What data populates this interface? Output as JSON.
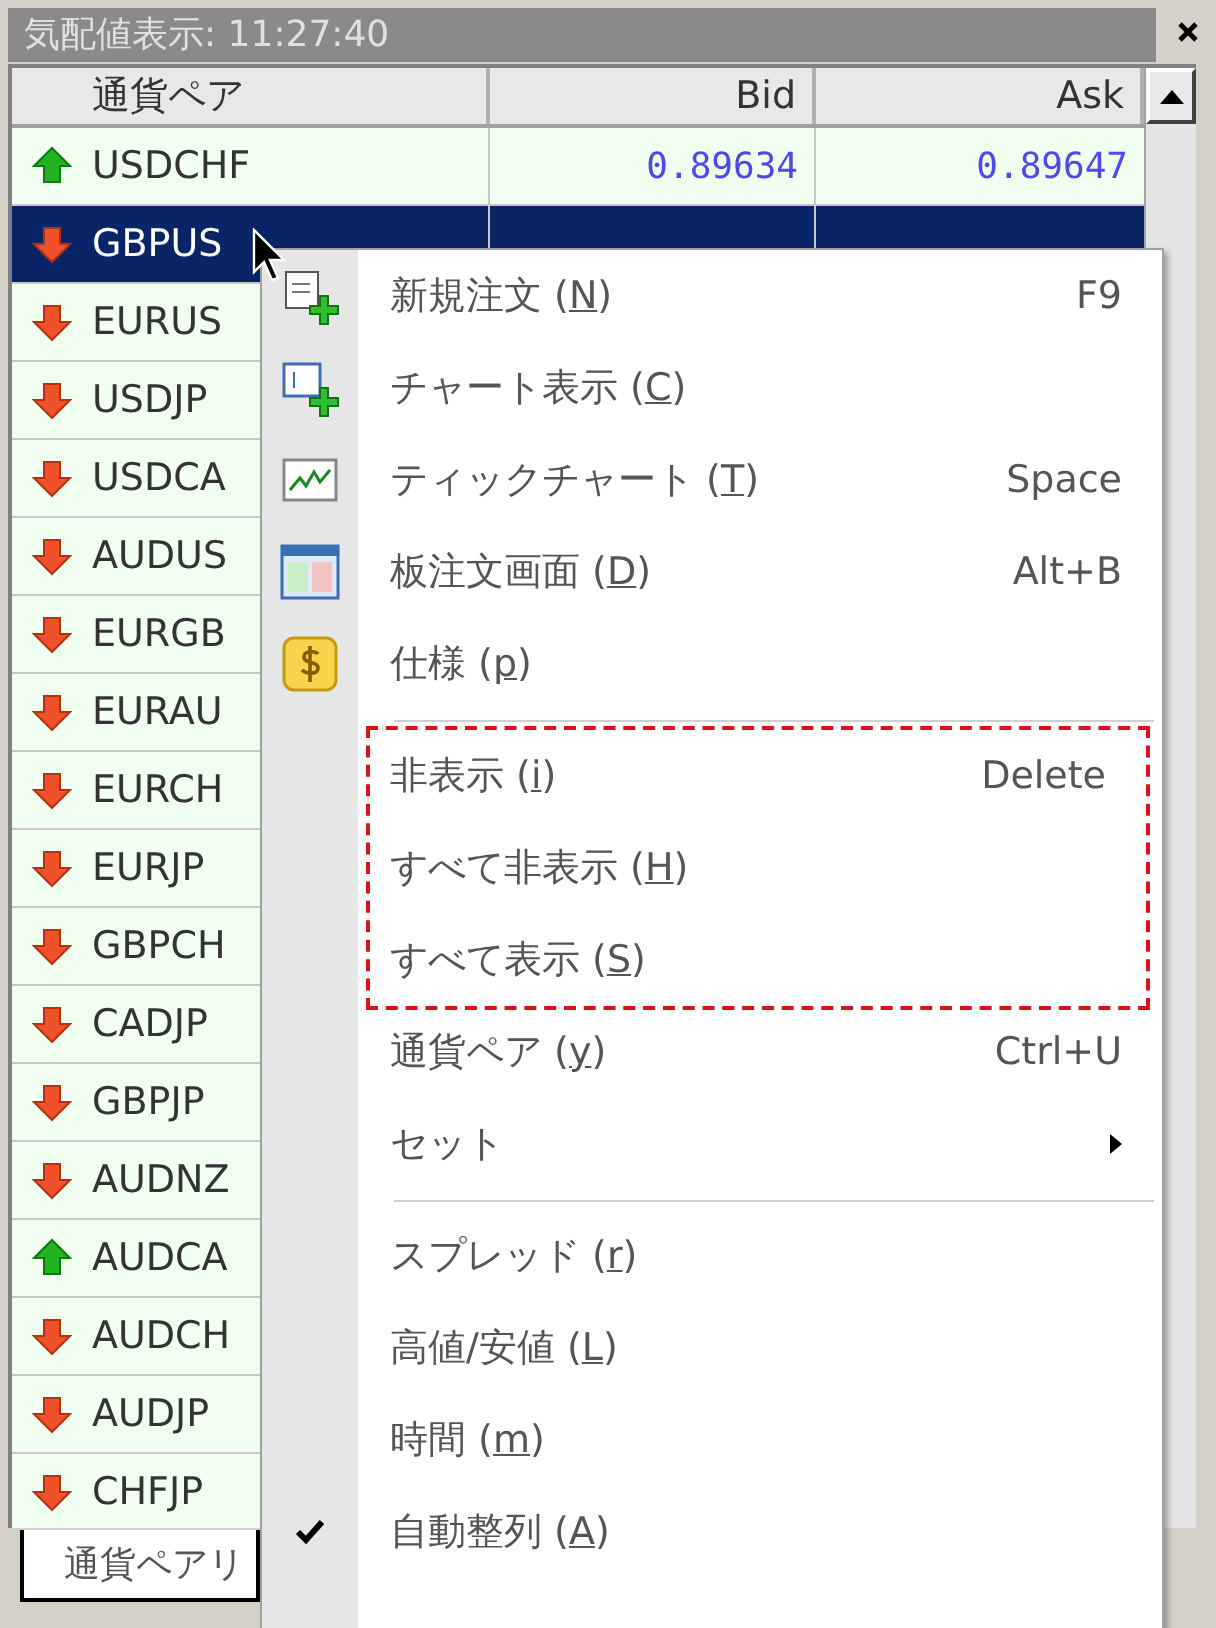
{
  "window": {
    "title": "気配値表示: 11:27:40"
  },
  "table": {
    "columns": [
      "通貨ペア",
      "Bid",
      "Ask"
    ],
    "rows": [
      {
        "symbol": "USDCHF",
        "rising": true,
        "bid": "0.89634",
        "ask": "0.89647",
        "selected": false
      },
      {
        "symbol": "GBPUS",
        "rising": false,
        "selected": true
      },
      {
        "symbol": "EURUS",
        "rising": false,
        "selected": false
      },
      {
        "symbol": "USDJP",
        "rising": false,
        "selected": false
      },
      {
        "symbol": "USDCA",
        "rising": false,
        "selected": false
      },
      {
        "symbol": "AUDUS",
        "rising": false,
        "selected": false
      },
      {
        "symbol": "EURGB",
        "rising": false,
        "selected": false
      },
      {
        "symbol": "EURAU",
        "rising": false,
        "selected": false
      },
      {
        "symbol": "EURCH",
        "rising": false,
        "selected": false
      },
      {
        "symbol": "EURJP",
        "rising": false,
        "selected": false
      },
      {
        "symbol": "GBPCH",
        "rising": false,
        "selected": false
      },
      {
        "symbol": "CADJP",
        "rising": false,
        "selected": false
      },
      {
        "symbol": "GBPJP",
        "rising": false,
        "selected": false
      },
      {
        "symbol": "AUDNZ",
        "rising": false,
        "selected": false
      },
      {
        "symbol": "AUDCA",
        "rising": true,
        "selected": false
      },
      {
        "symbol": "AUDCH",
        "rising": false,
        "selected": false
      },
      {
        "symbol": "AUDJP",
        "rising": false,
        "selected": false
      },
      {
        "symbol": "CHFJP",
        "rising": false,
        "selected": false
      }
    ]
  },
  "bottom_tab": {
    "label": "通貨ペアリ"
  },
  "context_menu": {
    "sections": [
      {
        "divider": false,
        "outlined": false,
        "items": [
          {
            "before": "新規注文 (",
            "mnemonic": "N",
            "after": ")",
            "shortcut": "F9",
            "checked": false
          },
          {
            "before": "チャート表示 (",
            "mnemonic": "C",
            "after": ")",
            "checked": false
          },
          {
            "before": "ティックチャート (",
            "mnemonic": "T",
            "after": ")",
            "shortcut": "Space",
            "checked": false
          },
          {
            "before": "板注文画面 (",
            "mnemonic": "D",
            "after": ")",
            "shortcut": "Alt+B",
            "checked": false
          },
          {
            "before": "仕様 (",
            "mnemonic": "p",
            "after": ")",
            "checked": false
          }
        ]
      },
      {
        "divider": true,
        "outlined": true,
        "items": [
          {
            "before": "非表示 (",
            "mnemonic": "i",
            "after": ")",
            "shortcut": "Delete",
            "checked": false
          },
          {
            "before": "すべて非表示 (",
            "mnemonic": "H",
            "after": ")",
            "checked": false
          },
          {
            "before": "すべて表示 (",
            "mnemonic": "S",
            "after": ")",
            "checked": false
          }
        ]
      },
      {
        "divider": false,
        "outlined": false,
        "items": [
          {
            "before": "通貨ペア (",
            "mnemonic": "y",
            "after": ")",
            "shortcut": "Ctrl+U",
            "checked": false
          },
          {
            "before": "セット",
            "submenu": true,
            "checked": false
          }
        ]
      },
      {
        "divider": true,
        "outlined": false,
        "items": [
          {
            "before": "スプレッド (",
            "mnemonic": "r",
            "after": ")",
            "checked": false
          },
          {
            "before": "高値/安値 (",
            "mnemonic": "L",
            "after": ")",
            "checked": false
          },
          {
            "before": "時間 (",
            "mnemonic": "m",
            "after": ")",
            "checked": false
          },
          {
            "before": "自動整列 (",
            "mnemonic": "A",
            "after": ")",
            "checked": true
          }
        ]
      }
    ]
  }
}
